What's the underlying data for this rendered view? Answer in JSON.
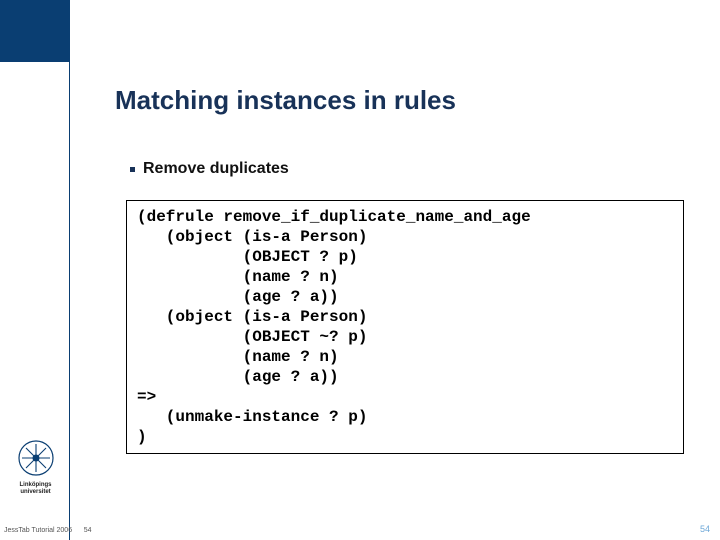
{
  "title": "Matching instances in rules",
  "bullet": "Remove duplicates",
  "code": "(defrule remove_if_duplicate_name_and_age\n   (object (is-a Person)\n           (OBJECT ? p)\n           (name ? n)\n           (age ? a))\n   (object (is-a Person)\n           (OBJECT ~? p)\n           (name ? n)\n           (age ? a))\n=>\n   (unmake-instance ? p)\n)",
  "university": "Linköpings universitet",
  "footer_left": "JessTab Tutorial 2006",
  "footer_center": "54",
  "footer_right": "54",
  "colors": {
    "brand_dark": "#0a3e72",
    "heading": "#183258"
  }
}
